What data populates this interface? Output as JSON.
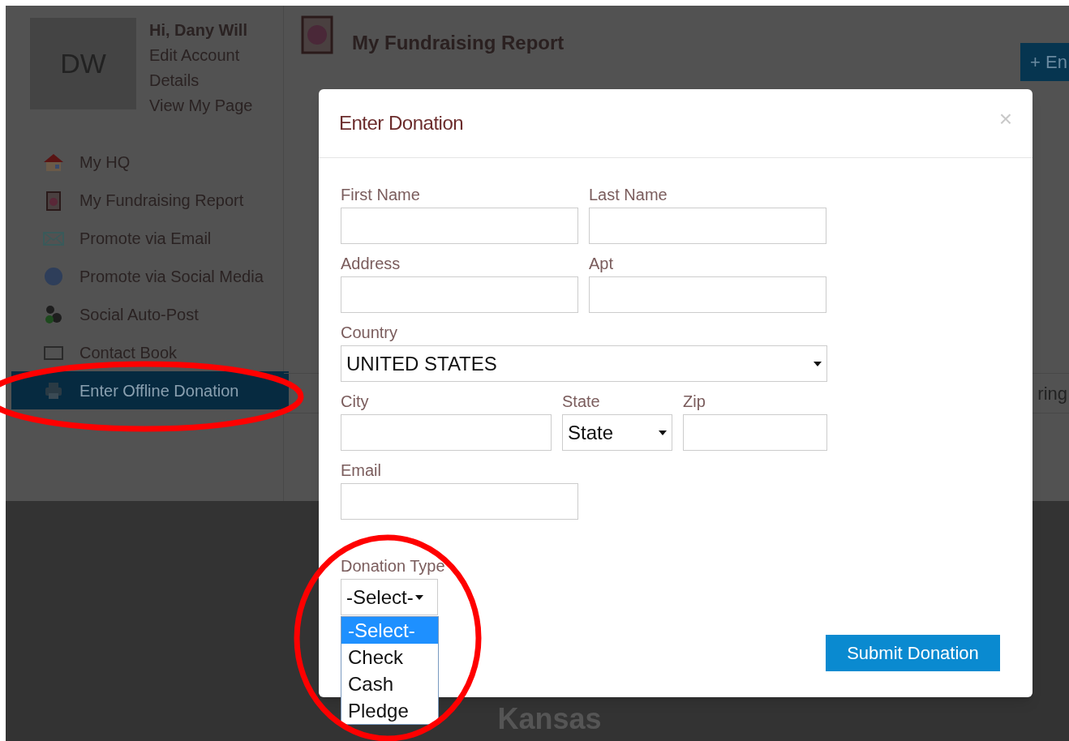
{
  "sidebar": {
    "avatar_initials": "DW",
    "greeting": "Hi, Dany Will",
    "links": [
      "Edit Account Details",
      "View My Page"
    ],
    "nav": [
      {
        "label": "My HQ",
        "selected": false
      },
      {
        "label": "My Fundraising Report",
        "selected": false
      },
      {
        "label": "Promote via Email",
        "selected": false
      },
      {
        "label": "Promote via Social Media",
        "selected": false
      },
      {
        "label": "Social Auto-Post",
        "selected": false
      },
      {
        "label": "Contact Book",
        "selected": false
      },
      {
        "label": "Enter Offline Donation",
        "selected": true
      }
    ]
  },
  "main": {
    "title": "My Fundraising Report",
    "action_button": "+ En",
    "table_header_fragment": "ring",
    "footer_text": "Kansas"
  },
  "modal": {
    "title": "Enter Donation",
    "close": "×",
    "rows": [
      [
        {
          "label": "First Name",
          "kind": "text"
        },
        {
          "label": "Last Name",
          "kind": "text"
        }
      ],
      [
        {
          "label": "Address",
          "kind": "text"
        },
        {
          "label": "Apt",
          "kind": "text"
        }
      ],
      [
        {
          "label": "Country",
          "kind": "select",
          "value": "UNITED STATES"
        }
      ],
      [
        {
          "label": "City",
          "kind": "text"
        },
        {
          "label": "State",
          "kind": "select",
          "value": "State"
        },
        {
          "label": "Zip",
          "kind": "text"
        }
      ],
      [
        {
          "label": "Email",
          "kind": "text"
        }
      ]
    ],
    "donation_type": {
      "label": "Donation Type",
      "value": "-Select-",
      "expanded": true,
      "options": [
        {
          "label": "-Select-",
          "selected": true
        },
        {
          "label": "Check",
          "selected": false
        },
        {
          "label": "Cash",
          "selected": false
        },
        {
          "label": "Pledge",
          "selected": false
        }
      ]
    },
    "submit": "Submit Donation"
  }
}
